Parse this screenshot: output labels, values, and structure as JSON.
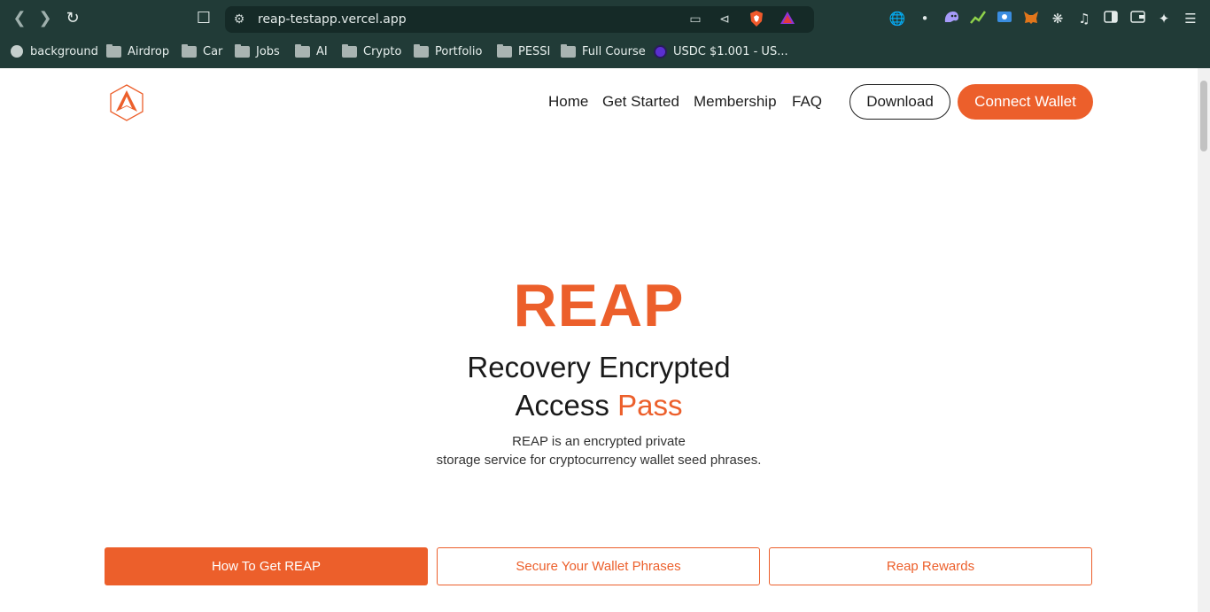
{
  "browser": {
    "url": "reap-testapp.vercel.app",
    "icons": {
      "back": "back-arrow-icon",
      "forward": "forward-arrow-icon",
      "reload": "reload-icon",
      "bookmark": "bookmark-icon",
      "site_settings": "site-settings-icon",
      "install": "install-app-icon",
      "share": "share-icon"
    },
    "bookmarks": [
      {
        "label": "background",
        "icon": "globe-icon"
      },
      {
        "label": "Airdrop",
        "icon": "folder-icon"
      },
      {
        "label": "Car",
        "icon": "folder-icon"
      },
      {
        "label": "Jobs",
        "icon": "folder-icon"
      },
      {
        "label": "AI",
        "icon": "folder-icon"
      },
      {
        "label": "Crypto",
        "icon": "folder-icon"
      },
      {
        "label": "Portfolio",
        "icon": "folder-icon"
      },
      {
        "label": "PESSI",
        "icon": "folder-icon"
      },
      {
        "label": "Full Course",
        "icon": "folder-icon"
      },
      {
        "label": "USDC $1.001 - US...",
        "icon": "coin-icon"
      }
    ]
  },
  "site": {
    "nav": {
      "home": "Home",
      "get_started": "Get Started",
      "membership": "Membership",
      "faq": "FAQ",
      "download": "Download",
      "connect_wallet": "Connect Wallet"
    },
    "hero": {
      "title": "REAP",
      "subtitle_line1": "Recovery Encrypted",
      "subtitle_line2_prefix": "Access",
      "subtitle_line2_accent": "Pass",
      "desc_line1": "REAP is an encrypted private",
      "desc_line2": "storage service for cryptocurrency wallet seed phrases."
    },
    "tabs": [
      {
        "label": "How To Get REAP"
      },
      {
        "label": "Secure Your Wallet Phrases"
      },
      {
        "label": "Reap Rewards"
      }
    ],
    "colors": {
      "accent": "#ec5f2b",
      "text": "#1a1a1a",
      "chrome_bg": "#213b37"
    }
  }
}
